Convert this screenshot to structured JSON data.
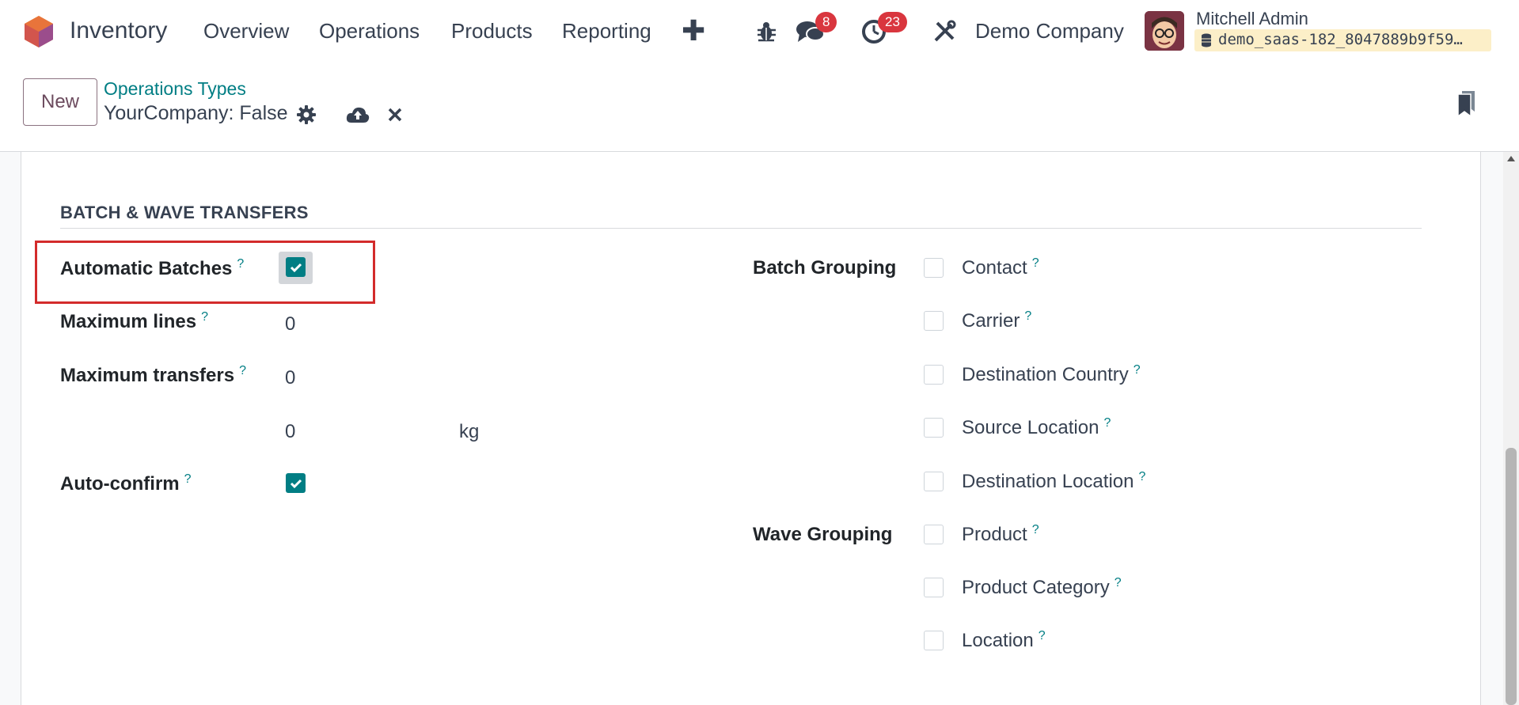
{
  "navbar": {
    "app_name": "Inventory",
    "menu": [
      "Overview",
      "Operations",
      "Products",
      "Reporting"
    ],
    "plus": "✚",
    "messages_count": "8",
    "activities_count": "23",
    "company": "Demo Company",
    "user_name": "Mitchell Admin",
    "database": "demo_saas-182_8047889b9f59…"
  },
  "control": {
    "new_label": "New",
    "breadcrumb": "Operations Types",
    "record_title": "YourCompany: False"
  },
  "section": {
    "title": "BATCH & WAVE TRANSFERS",
    "help_mark": "?",
    "automatic_batches": {
      "label": "Automatic Batches",
      "checked": true
    },
    "maximum_lines": {
      "label": "Maximum lines",
      "value": "0"
    },
    "maximum_transfers": {
      "label": "Maximum transfers",
      "value": "0"
    },
    "weight": {
      "value": "0",
      "unit": "kg"
    },
    "auto_confirm": {
      "label": "Auto-confirm",
      "checked": true
    },
    "batch_grouping": {
      "label": "Batch Grouping",
      "options": [
        "Contact",
        "Carrier",
        "Destination Country",
        "Source Location",
        "Destination Location"
      ]
    },
    "wave_grouping": {
      "label": "Wave Grouping",
      "options": [
        "Product",
        "Product Category",
        "Location"
      ]
    }
  },
  "colors": {
    "accent": "#017e84",
    "badge": "#d9363e",
    "highlight": "#d32b2b",
    "new_button": "#6c4b5e"
  },
  "icons": [
    "bug-icon",
    "chat-icon",
    "clock-icon",
    "tools-icon",
    "gear-icon",
    "cloud-upload-icon",
    "close-icon",
    "bookmark-icon",
    "database-icon",
    "check-icon"
  ]
}
